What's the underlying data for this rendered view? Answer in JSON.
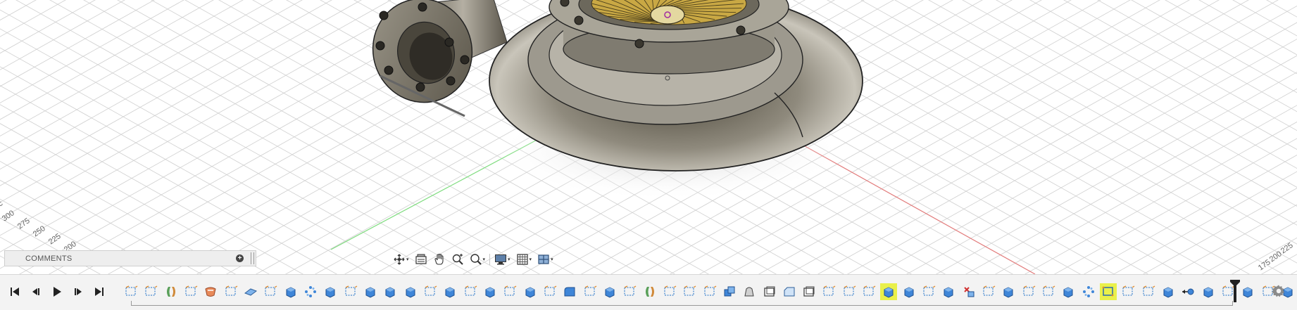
{
  "viewport": {
    "axis_labels": [
      "300",
      "275",
      "250",
      "225",
      "200"
    ],
    "axis_labels_right": [
      "175",
      "200",
      "225"
    ],
    "axis_label_left_partial": "c",
    "colors": {
      "grid": "#cfcfcf",
      "x_axis": "#e06a6a",
      "y_axis": "#6fd26f",
      "body": "#8f8a7d",
      "impeller": "#c9a844"
    }
  },
  "comments": {
    "label": "COMMENTS",
    "add_icon": "plus-circle-icon"
  },
  "navbar": {
    "items": [
      {
        "name": "orbit-icon",
        "has_menu": true
      },
      {
        "name": "look-at-icon",
        "has_menu": false
      },
      {
        "name": "pan-hand-icon",
        "has_menu": false
      },
      {
        "name": "zoom-icon",
        "has_menu": false
      },
      {
        "name": "zoom-window-icon",
        "has_menu": true
      },
      {
        "name": "display-settings-icon",
        "has_menu": true
      },
      {
        "name": "grid-settings-icon",
        "has_menu": true
      },
      {
        "name": "viewports-icon",
        "has_menu": true
      }
    ]
  },
  "timeline": {
    "playback": [
      "go-to-start-icon",
      "step-back-icon",
      "play-icon",
      "step-forward-icon",
      "go-to-end-icon"
    ],
    "features": [
      "sketch",
      "sketch",
      "revolve",
      "sketch",
      "sweep",
      "sketch",
      "plane",
      "sketch",
      "extrude",
      "pattern",
      "extrude",
      "sketch",
      "extrude",
      "extrude",
      "extrude",
      "sketch",
      "extrude",
      "sketch",
      "extrude",
      "sketch",
      "extrude",
      "sketch",
      "fillet",
      "sketch",
      "extrude",
      "sketch",
      "revolve",
      "sketch",
      "sketch",
      "sketch",
      "combine",
      "loft",
      "shell",
      "chamfer",
      "shell",
      "sketch",
      "sketch",
      "sketch",
      "extrude-highlight",
      "extrude",
      "sketch",
      "extrude",
      "delete",
      "sketch",
      "extrude",
      "sketch",
      "sketch",
      "extrude",
      "pattern",
      "sketch-highlight",
      "sketch",
      "sketch",
      "extrude",
      "joint",
      "extrude",
      "sketch",
      "extrude",
      "sketch",
      "extrude",
      "pattern"
    ],
    "highlighted": [
      38,
      49
    ],
    "end_icon": "move-icon",
    "marker_icon": "timeline-marker-icon",
    "settings_icon": "gear-icon"
  }
}
